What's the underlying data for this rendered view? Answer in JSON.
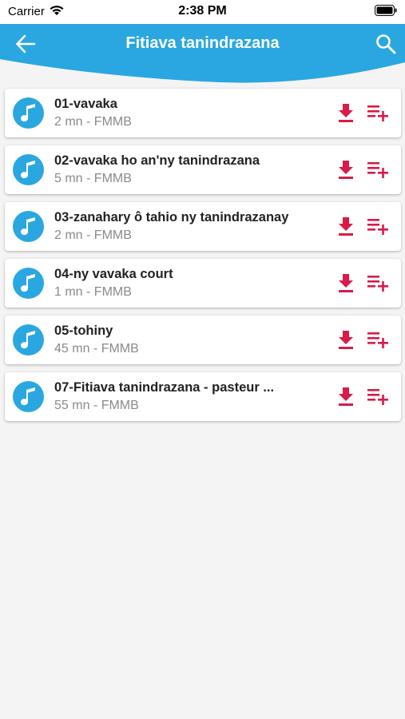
{
  "status_bar": {
    "carrier": "Carrier",
    "time": "2:38 PM"
  },
  "header": {
    "title": "Fitiava tanindrazana",
    "back_icon": "arrow-left-icon",
    "search_icon": "search-icon",
    "color": "#2aa7e0"
  },
  "colors": {
    "accent": "#2aa7e0",
    "action": "#d81b47",
    "background": "#f4f4f5"
  },
  "tracks": [
    {
      "title": "01-vavaka",
      "subtitle": "2 mn - FMMB"
    },
    {
      "title": "02-vavaka ho an'ny tanindrazana",
      "subtitle": "5 mn - FMMB"
    },
    {
      "title": "03-zanahary ô tahio ny tanindrazanay",
      "subtitle": "2 mn - FMMB"
    },
    {
      "title": "04-ny vavaka court",
      "subtitle": "1 mn - FMMB"
    },
    {
      "title": "05-tohiny",
      "subtitle": "45 mn - FMMB"
    },
    {
      "title": "07-Fitiava tanindrazana - pasteur ...",
      "subtitle": "55 mn - FMMB"
    }
  ],
  "row_icons": {
    "avatar": "music-note-icon",
    "download": "download-icon",
    "add_to_playlist": "playlist-add-icon"
  }
}
